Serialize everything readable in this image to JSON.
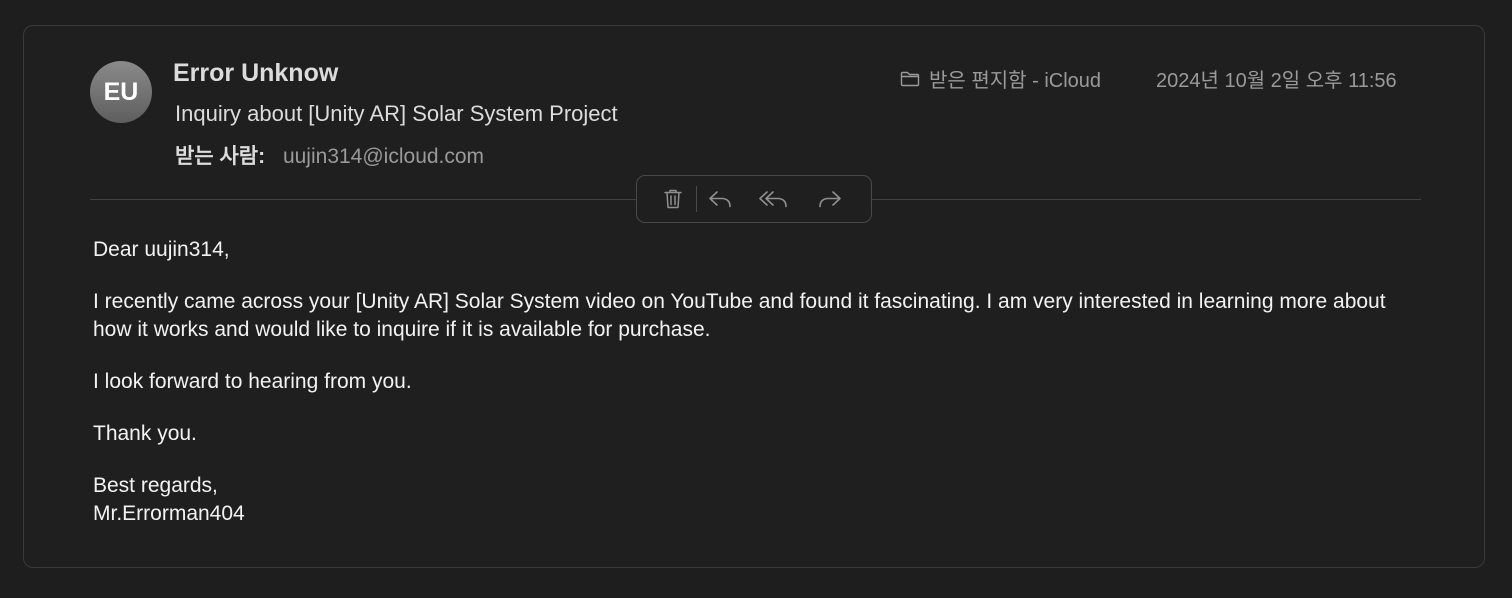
{
  "email": {
    "avatar_initials": "EU",
    "sender": "Error Unknow",
    "subject": "Inquiry about [Unity AR] Solar System Project",
    "to_label": "받는 사람:",
    "to_address": "uujin314@icloud.com",
    "mailbox": "받은 편지함 - iCloud",
    "date": "2024년 10월 2일 오후 11:56"
  },
  "toolbar": {
    "icons": [
      "trash-icon",
      "reply-icon",
      "reply-all-icon",
      "forward-icon"
    ]
  },
  "body": {
    "greeting": "Dear uujin314,",
    "paragraph1": "I recently came across your [Unity AR] Solar System video on YouTube and found it fascinating. I am very interested in learning more about how it works and would like to inquire if it is available for purchase.",
    "paragraph2": "I look forward to hearing from you.",
    "paragraph3": "Thank you.",
    "closing": "Best regards,",
    "signature": "Mr.Errorman404"
  },
  "colors": {
    "background": "#1e1e1e",
    "card": "#1f1f1f",
    "text_primary": "#dcdcdc",
    "text_secondary": "#9a9a9a",
    "body_text": "#f2f2f2"
  }
}
